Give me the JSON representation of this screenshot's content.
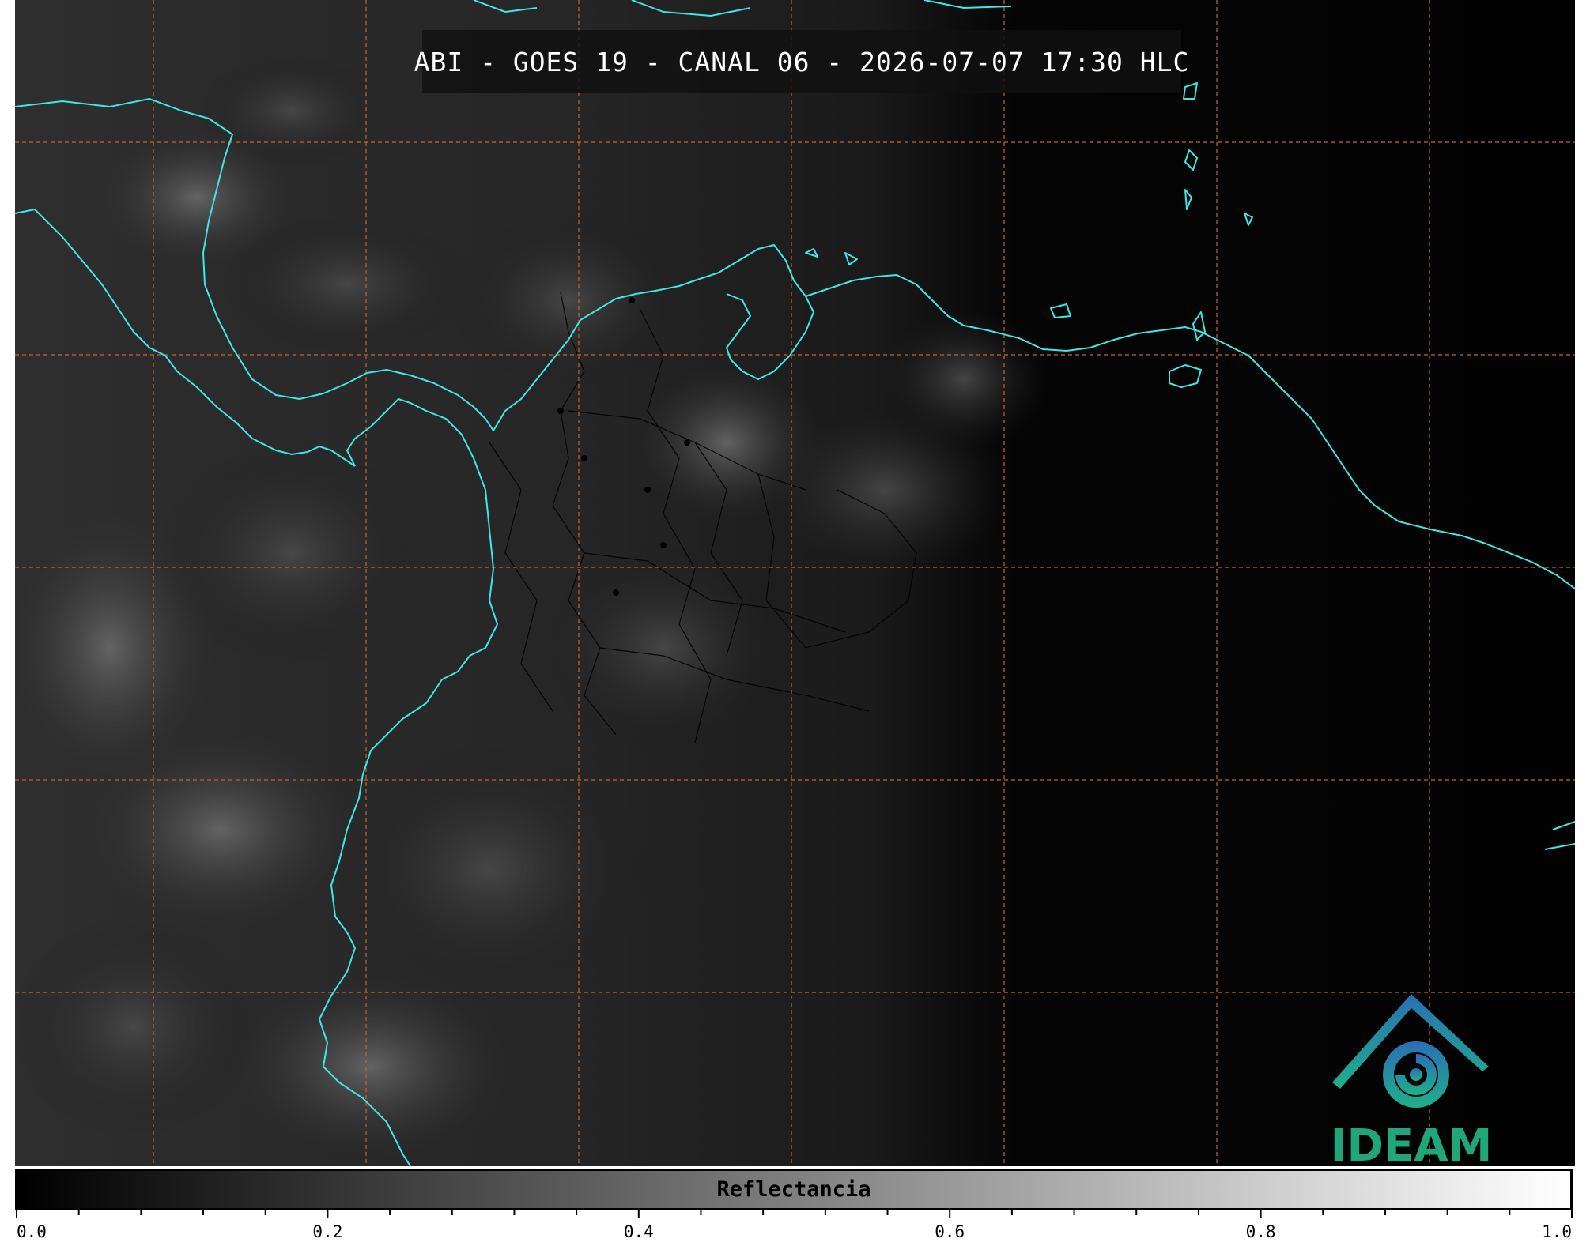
{
  "title": "ABI - GOES 19 - CANAL 06 - 2026-07-07 17:30 HLC",
  "logo": {
    "text": "IDEAM",
    "icon": "ideam-logo-icon",
    "color": "#1fa67a"
  },
  "colorbar": {
    "label": "Reflectancia",
    "min": 0.0,
    "max": 1.0,
    "tick_labels": [
      "0.0",
      "0.2",
      "0.4",
      "0.6",
      "0.8",
      "1.0"
    ],
    "colormap": [
      "#000000",
      "#ffffff"
    ]
  },
  "map": {
    "coastline_color": "#3ee6e6",
    "grid_color": "#c8642a",
    "border_color": "#000000"
  }
}
